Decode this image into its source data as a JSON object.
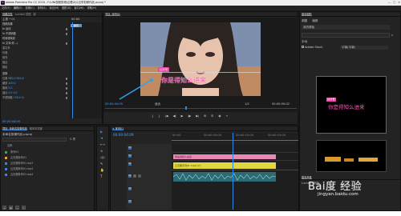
{
  "window": {
    "title": "Adobe Premiere Pro CC 2018 - F:\\UNI视频剪辑\\边看大片边学剪辑作品.prproj *",
    "logo": "Pr",
    "controls": [
      "—",
      "□",
      "✕"
    ]
  },
  "menu": [
    "文件(F)",
    "编辑(E)",
    "剪辑(C)",
    "序列(S)",
    "标记(M)",
    "图形(G)",
    "窗口(W)",
    "帮助(H)"
  ],
  "effect_controls": {
    "tabs": [
      "效果控件",
      "Lumetri 范围",
      "源"
    ],
    "master_label": "主要 * 01",
    "sequence_label": "序列01 * 01",
    "timecode_head": "00:00",
    "clip_tag": "图形",
    "rows": [
      {
        "label": "视频效果",
        "value": "",
        "cls": "sect"
      },
      {
        "label": "fx  运动",
        "value": "",
        "cls": "sect"
      },
      {
        "label": "fx  不透明度",
        "value": "",
        "cls": "sect"
      },
      {
        "label": "   时间重映射",
        "value": "",
        "cls": "sect"
      },
      {
        "label": "fx  文本(你...)",
        "value": "",
        "cls": "sect"
      },
      {
        "label": "   源文本",
        "value": "",
        "cls": ""
      },
      {
        "label": "   外观",
        "value": "",
        "cls": ""
      },
      {
        "label": "   填充",
        "value": "",
        "cls": ""
      },
      {
        "label": "   描边",
        "value": "",
        "cls": ""
      },
      {
        "label": "   阴影",
        "value": "",
        "cls": ""
      },
      {
        "label": "变换",
        "value": "",
        "cls": "sect"
      },
      {
        "label": "   位置",
        "value": "960.0  540.0",
        "cls": ""
      },
      {
        "label": "   缩放",
        "value": "100.0",
        "cls": ""
      },
      {
        "label": "   旋转",
        "value": "0.0",
        "cls": ""
      },
      {
        "label": "   锚点",
        "value": "0.0  0.0",
        "cls": ""
      },
      {
        "label": "   不透明度",
        "value": "100.0 %",
        "cls": ""
      }
    ],
    "timecode": "00:00:04:09"
  },
  "program": {
    "tabs": [
      "节目: 序列01"
    ],
    "caption_text": "你是得知么进来",
    "small_tag": "公众号",
    "timecode_left": "00:00:04:09",
    "fit": "适合",
    "ratio": "1/2",
    "timecode_right": "00:00:05:02",
    "transport": [
      "{",
      "}",
      "|◀",
      "◀|",
      "▶",
      "|▶",
      "▶|",
      "⊞",
      "⊟",
      "◉",
      "+"
    ]
  },
  "project": {
    "tabs": [
      "项目: 未命名剪辑作品",
      "媒体浏览器"
    ],
    "path": "未命名剪辑作品.prproj",
    "search_placeholder": "",
    "item_count": "5 项",
    "items": [
      {
        "name": "名称",
        "color": ""
      },
      {
        "name": "序列01",
        "color": "#3fa34d"
      },
      {
        "name": "云无期序列01",
        "color": "#e0a24a"
      },
      {
        "name": "云无期序列01.mp3",
        "color": "#4a7ec9"
      },
      {
        "name": "云无期序列01.mp4",
        "color": "#4a7ec9"
      },
      {
        "name": "云无期序列01.mp4",
        "color": "#4a7ec9"
      }
    ]
  },
  "timeline": {
    "tab": "× 序列01",
    "timecode": "00:00:04:09",
    "ruler_marks": [
      "00:00",
      "00:00:05:00",
      "00:00:10:00",
      "00:00:15:00",
      "00:00:20:00"
    ],
    "tracks": [
      {
        "id": "V3",
        "type": "video"
      },
      {
        "id": "V2",
        "type": "video"
      },
      {
        "id": "V1",
        "type": "video"
      },
      {
        "id": "A1",
        "type": "audio"
      },
      {
        "id": "A2",
        "type": "audio"
      },
      {
        "id": "A3",
        "type": "audio"
      }
    ],
    "clip_yellow_label": "云无期序列01.mp4 [V]",
    "clip_pink_label": "你是得知么进来",
    "track_buttons": [
      "M",
      "S",
      "◉"
    ]
  },
  "essential_graphics": {
    "title": "基本图形",
    "tabs": [
      "浏览",
      "编辑"
    ],
    "folder_label": "我的模板",
    "section_label": "本地",
    "checkbox_label": "Adobe Stock",
    "dropdown_value": "字幕(字幕)",
    "preview_caption": "你是得知么进来",
    "preview_tag": "公众号",
    "bottom_tabs": [
      "基本声音"
    ],
    "footer_label": "Lumetri 颜色"
  },
  "tools": [
    "▶",
    "⇥",
    "⟷",
    "⨯",
    "◁▷",
    "✎",
    "✋",
    "T"
  ],
  "colors": {
    "accent": "#2d8ceb",
    "panel_bg": "#232323",
    "pink_clip": "#e889b5",
    "yellow_clip": "#e0d640",
    "audio_clip": "#2c6b73",
    "caption": "#ff4fb8"
  },
  "watermark": "jingyan.baidu.com",
  "watermark_logo": "Bai度 经验"
}
